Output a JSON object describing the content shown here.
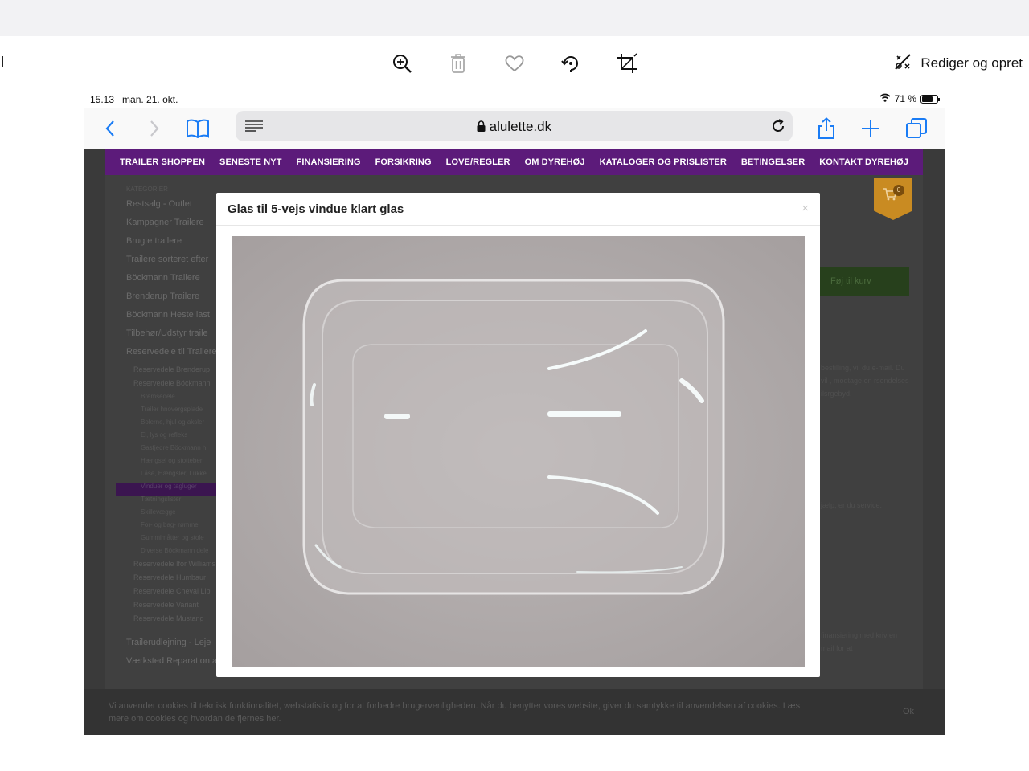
{
  "photos_app": {
    "toolbar": {
      "zoom_icon": "zoom-in-icon",
      "delete_icon": "trash-icon",
      "favorite_icon": "heart-icon",
      "rotate_icon": "rotate-icon",
      "crop_icon": "crop-icon",
      "edit_label": "Rediger og opret"
    }
  },
  "ipad": {
    "status": {
      "time": "15.13",
      "date": "man. 21. okt.",
      "battery": "71 %"
    },
    "safari": {
      "url": "alulette.dk"
    },
    "site": {
      "nav": [
        "TRAILER SHOPPEN",
        "SENESTE NYT",
        "FINANSIERING",
        "FORSIKRING",
        "LOVE/REGLER",
        "OM DYREHØJ",
        "KATALOGER OG PRISLISTER",
        "BETINGELSER",
        "KONTAKT DYREHØJ"
      ],
      "sidebar": {
        "heading": "KATEGORIER",
        "items": [
          "Restsalg - Outlet",
          "Kampagner Trailere",
          "Brugte trailere",
          "Trailere sorteret efter",
          "Böckmann Trailere",
          "Brenderup Trailere",
          "Böckmann Heste last",
          "Tilbehør/Udstyr traile",
          "Reservedele til Trailere"
        ],
        "sub_items_a": [
          "Reservedele Brenderup",
          "Reservedele Böckmann"
        ],
        "sub_sub_items": [
          "Bremsedele",
          "Trailer hnovergsplade",
          "Bolerne, hjul og aksler",
          "El, lys og refleks",
          "Gasfjedre Böckmann h",
          "Hængsel og stotteben",
          "Låse, Hængsler, Lukke",
          "Vinduer og tagluger",
          "Tætningslister",
          "Skillevægge",
          "For- og bag- rømme",
          "Gummimåtter og stole",
          "Diverse Böckmann dele"
        ],
        "sub_items_b": [
          "Reservedele Ifor Williams",
          "Reservedele Humbaur",
          "Reservedele Cheval Lib",
          "Reservedele Variant",
          "Reservedele Mustang"
        ],
        "bottom_items": [
          "Trailerudlejning - Leje",
          "Værksted Reparation af Trailer"
        ]
      },
      "cart_count": "0",
      "add_to_cart": "Føj til kurv",
      "right_text_1": "bestilling, vil du e-mail. Du vil , modtage en rsendelses ilsrgebyd.",
      "right_text_2": "jælp, er du service.",
      "right_text_3": "finansiering med kriv en mail for at",
      "cookie": {
        "text": "Vi anvender cookies til teknisk funktionalitet, webstatistik og for at forbedre brugervenligheden. Når du benytter vores website, giver du samtykke til anvendelsen af cookies. Læs mere om cookies og hvordan de fjernes her.",
        "ok": "Ok"
      }
    },
    "modal": {
      "title": "Glas til 5-vejs vindue klart glas",
      "close": "×"
    }
  }
}
